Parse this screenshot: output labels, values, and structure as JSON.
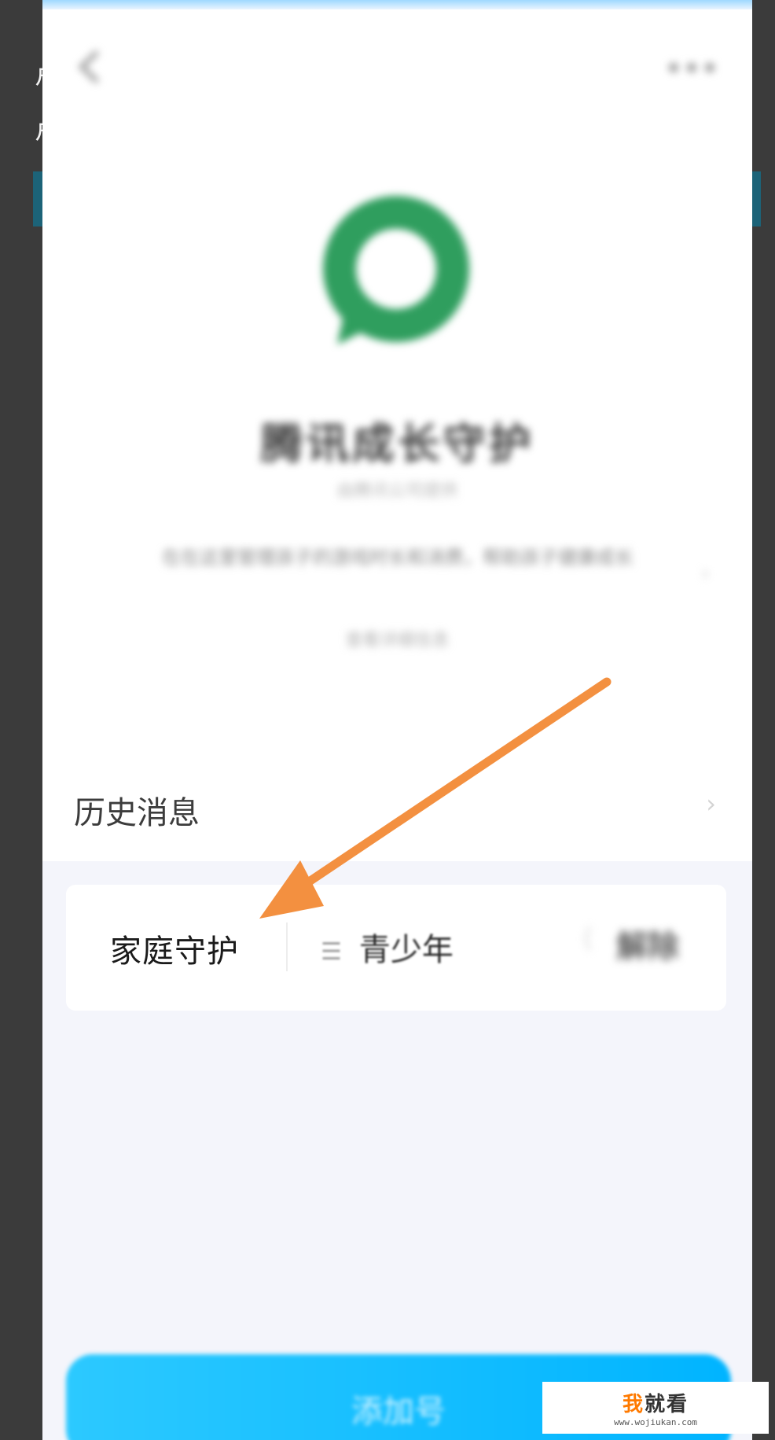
{
  "background": {
    "left_text_fragments": [
      "卢",
      "卢"
    ]
  },
  "header": {
    "title": "腾讯成长守护",
    "subtitle": "由腾讯公司提供",
    "description": "在在这里管理孩子的游戏时长和消费，帮助孩子健康成长",
    "link_text": "查看详细信息"
  },
  "history": {
    "label": "历史消息"
  },
  "guardian_card": {
    "label": "家庭守护",
    "role": "青少年",
    "action": "解除"
  },
  "bottom_button": {
    "label": "添加号"
  },
  "watermark": {
    "brand_accent": "我",
    "brand_rest": "就看",
    "url": "www.wojiukan.com"
  },
  "colors": {
    "logo_green": "#2f9e5e",
    "arrow": "#f39040",
    "button": "#1fc2ff"
  }
}
